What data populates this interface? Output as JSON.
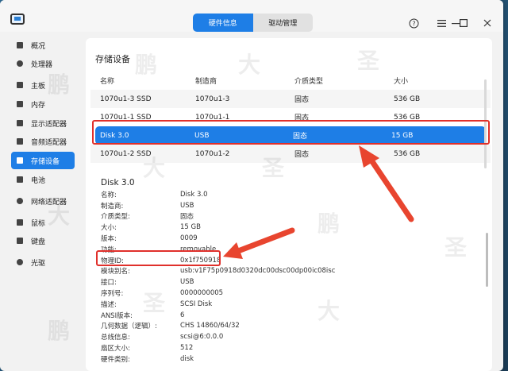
{
  "tabs": [
    {
      "label": "硬件信息",
      "active": true
    },
    {
      "label": "驱动管理",
      "active": false
    }
  ],
  "window_controls": [
    "help-icon",
    "menu-icon",
    "minimize-icon",
    "maximize-icon",
    "close-icon"
  ],
  "sidebar": {
    "items": [
      {
        "label": "概况",
        "icon": "overview-icon"
      },
      {
        "label": "处理器",
        "icon": "cpu-icon"
      },
      {
        "label": "主板",
        "icon": "motherboard-icon"
      },
      {
        "label": "内存",
        "icon": "memory-icon"
      },
      {
        "label": "显示适配器",
        "icon": "display-adapter-icon"
      },
      {
        "label": "音频适配器",
        "icon": "audio-adapter-icon"
      },
      {
        "label": "存储设备",
        "icon": "storage-icon",
        "active": true
      },
      {
        "label": "电池",
        "icon": "battery-icon"
      },
      {
        "label": "网络适配器",
        "icon": "network-adapter-icon"
      },
      {
        "label": "鼠标",
        "icon": "mouse-icon"
      },
      {
        "label": "键盘",
        "icon": "keyboard-icon"
      },
      {
        "label": "光驱",
        "icon": "optical-drive-icon"
      }
    ]
  },
  "section_title": "存储设备",
  "table": {
    "headers": [
      "名称",
      "制造商",
      "介质类型",
      "大小"
    ],
    "rows": [
      [
        "1070u1-3 SSD",
        "1070u1-3",
        "固态",
        "536 GB"
      ],
      [
        "1070u1-1 SSD",
        "1070u1-1",
        "固态",
        "536 GB"
      ],
      [
        "Disk 3.0",
        "USB",
        "固态",
        "15 GB"
      ],
      [
        "1070u1-2 SSD",
        "1070u1-2",
        "固态",
        "536 GB"
      ]
    ],
    "selected_index": 2
  },
  "detail": {
    "title": "Disk 3.0",
    "rows": [
      [
        "名称:",
        "Disk 3.0"
      ],
      [
        "制造商:",
        "USB"
      ],
      [
        "介质类型:",
        "固态"
      ],
      [
        "大小:",
        "15 GB"
      ],
      [
        "版本:",
        "0009"
      ],
      [
        "功能:",
        "removable"
      ],
      [
        "物理ID:",
        "0x1f750918"
      ],
      [
        "模块别名:",
        "usb:v1F75p0918d0320dc00dsc00dp00ic08isc"
      ],
      [
        "接口:",
        "USB"
      ],
      [
        "序列号:",
        "0000000005"
      ],
      [
        "描述:",
        "SCSI Disk"
      ],
      [
        "ANSI版本:",
        "6"
      ],
      [
        "几何数据（逻辑）:",
        "CHS 14860/64/32"
      ],
      [
        "总线信息:",
        "scsi@6:0.0.0"
      ],
      [
        "扇区大小:",
        "512"
      ],
      [
        "硬件类别:",
        "disk"
      ]
    ]
  },
  "watermark": "鹏 大 圣",
  "colors": {
    "accent": "#1e7ee6",
    "highlight_box": "#e0302b",
    "arrow": "#e8452f"
  }
}
